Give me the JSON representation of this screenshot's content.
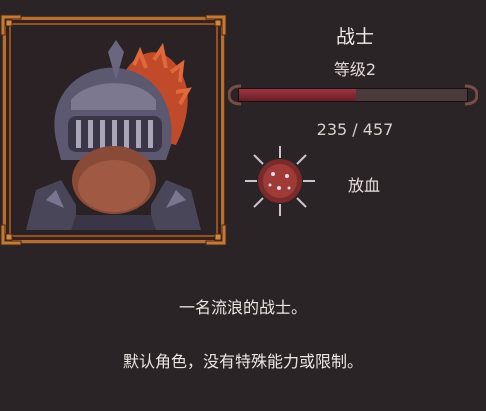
{
  "character": {
    "name": "战士",
    "level_text": "等级2",
    "hp_text": "235 / 457",
    "hp_current": 235,
    "hp_max": 457,
    "portrait_icon": "armored-knight-portrait"
  },
  "ability": {
    "label": "放血",
    "icon": "spiked-orb-bleed-icon"
  },
  "description": {
    "line1": "一名流浪的战士。",
    "line2": "默认角色，没有特殊能力或限制。"
  },
  "colors": {
    "background": "#2b2427",
    "frame_gold": "#b0703a",
    "hp_fill": "#8a2c36",
    "hp_track": "#4a3a3c"
  }
}
